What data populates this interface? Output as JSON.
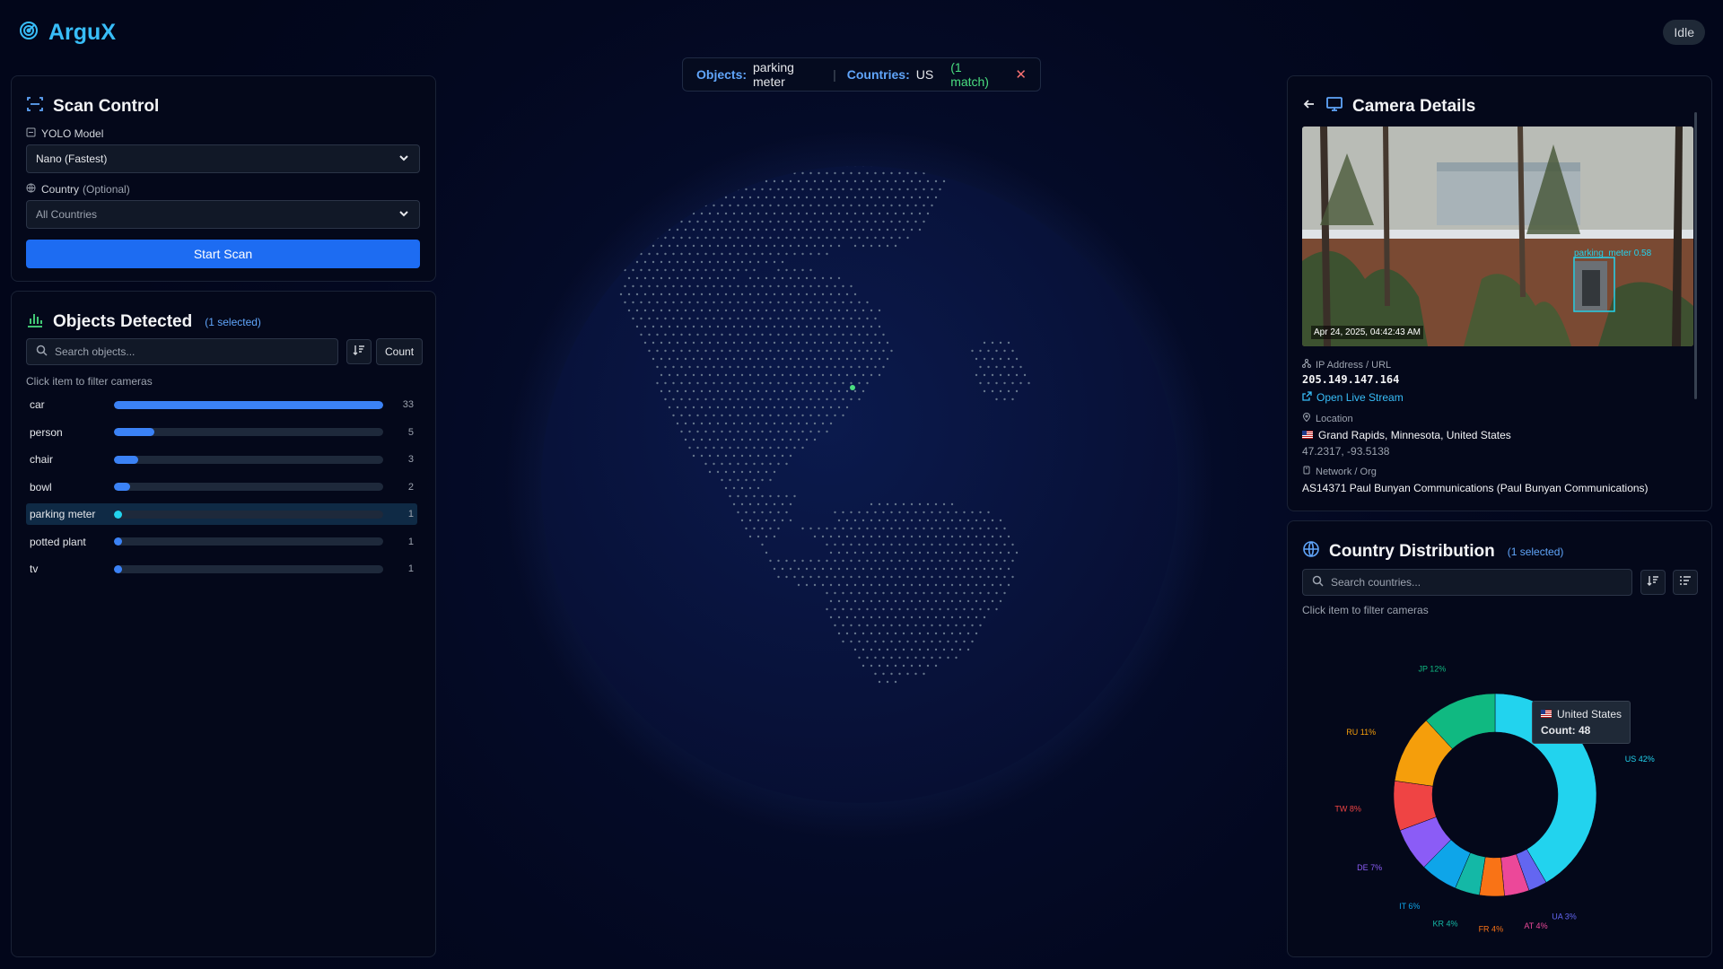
{
  "app": {
    "name": "ArguX",
    "status": "Idle"
  },
  "filter_bar": {
    "objects_key": "Objects:",
    "objects_value": "parking meter",
    "countries_key": "Countries:",
    "countries_value": "US",
    "match_text": "(1 match)",
    "close_glyph": "✕"
  },
  "scan_control": {
    "title": "Scan Control",
    "model_label": "YOLO Model",
    "model_value": "Nano (Fastest)",
    "country_label": "Country",
    "country_optional": "(Optional)",
    "country_value": "All Countries",
    "start_button": "Start Scan"
  },
  "objects_detected": {
    "title": "Objects Detected",
    "selected_note": "(1 selected)",
    "search_placeholder": "Search objects...",
    "count_button": "Count",
    "hint": "Click item to filter cameras",
    "items": [
      {
        "name": "car",
        "count": 33
      },
      {
        "name": "person",
        "count": 5
      },
      {
        "name": "chair",
        "count": 3
      },
      {
        "name": "bowl",
        "count": 2
      },
      {
        "name": "parking meter",
        "count": 1,
        "selected": true
      },
      {
        "name": "potted plant",
        "count": 1
      },
      {
        "name": "tv",
        "count": 1
      }
    ]
  },
  "camera_details": {
    "title": "Camera Details",
    "detection_label": "parking_meter 0.58",
    "timestamp": "Apr 24, 2025, 04:42:43 AM",
    "ip_label": "IP Address / URL",
    "ip_value": "205.149.147.164",
    "stream_link": "Open Live Stream",
    "location_label": "Location",
    "location_value": "Grand Rapids, Minnesota, United States",
    "coordinates": "47.2317, -93.5138",
    "network_label": "Network / Org",
    "network_value": "AS14371 Paul Bunyan Communications (Paul Bunyan Communications)"
  },
  "country_distribution": {
    "title": "Country Distribution",
    "selected_note": "(1 selected)",
    "search_placeholder": "Search countries...",
    "hint": "Click item to filter cameras",
    "tooltip_country": "United States",
    "tooltip_count": "Count: 48"
  },
  "chart_data": {
    "type": "pie",
    "variant": "donut",
    "slices": [
      {
        "label": "US 42%",
        "value": 42,
        "color": "#22d3ee"
      },
      {
        "label": "UA 3%",
        "value": 3,
        "color": "#6366f1"
      },
      {
        "label": "AT 4%",
        "value": 4,
        "color": "#ec4899"
      },
      {
        "label": "FR 4%",
        "value": 4,
        "color": "#f97316"
      },
      {
        "label": "KR 4%",
        "value": 4,
        "color": "#14b8a6"
      },
      {
        "label": "IT 6%",
        "value": 6,
        "color": "#0ea5e9"
      },
      {
        "label": "DE 7%",
        "value": 7,
        "color": "#8b5cf6"
      },
      {
        "label": "TW 8%",
        "value": 8,
        "color": "#ef4444"
      },
      {
        "label": "RU 11%",
        "value": 11,
        "color": "#f59e0b"
      },
      {
        "label": "JP 12%",
        "value": 12,
        "color": "#10b981"
      }
    ]
  },
  "colors": {
    "accent": "#38bdf8",
    "primary_button": "#1d6cf2",
    "bar_fill": "#3b82f6",
    "selected_bar_fill": "#22d3ee",
    "globe_dot": "#64748b",
    "marker": "#4ade80"
  }
}
